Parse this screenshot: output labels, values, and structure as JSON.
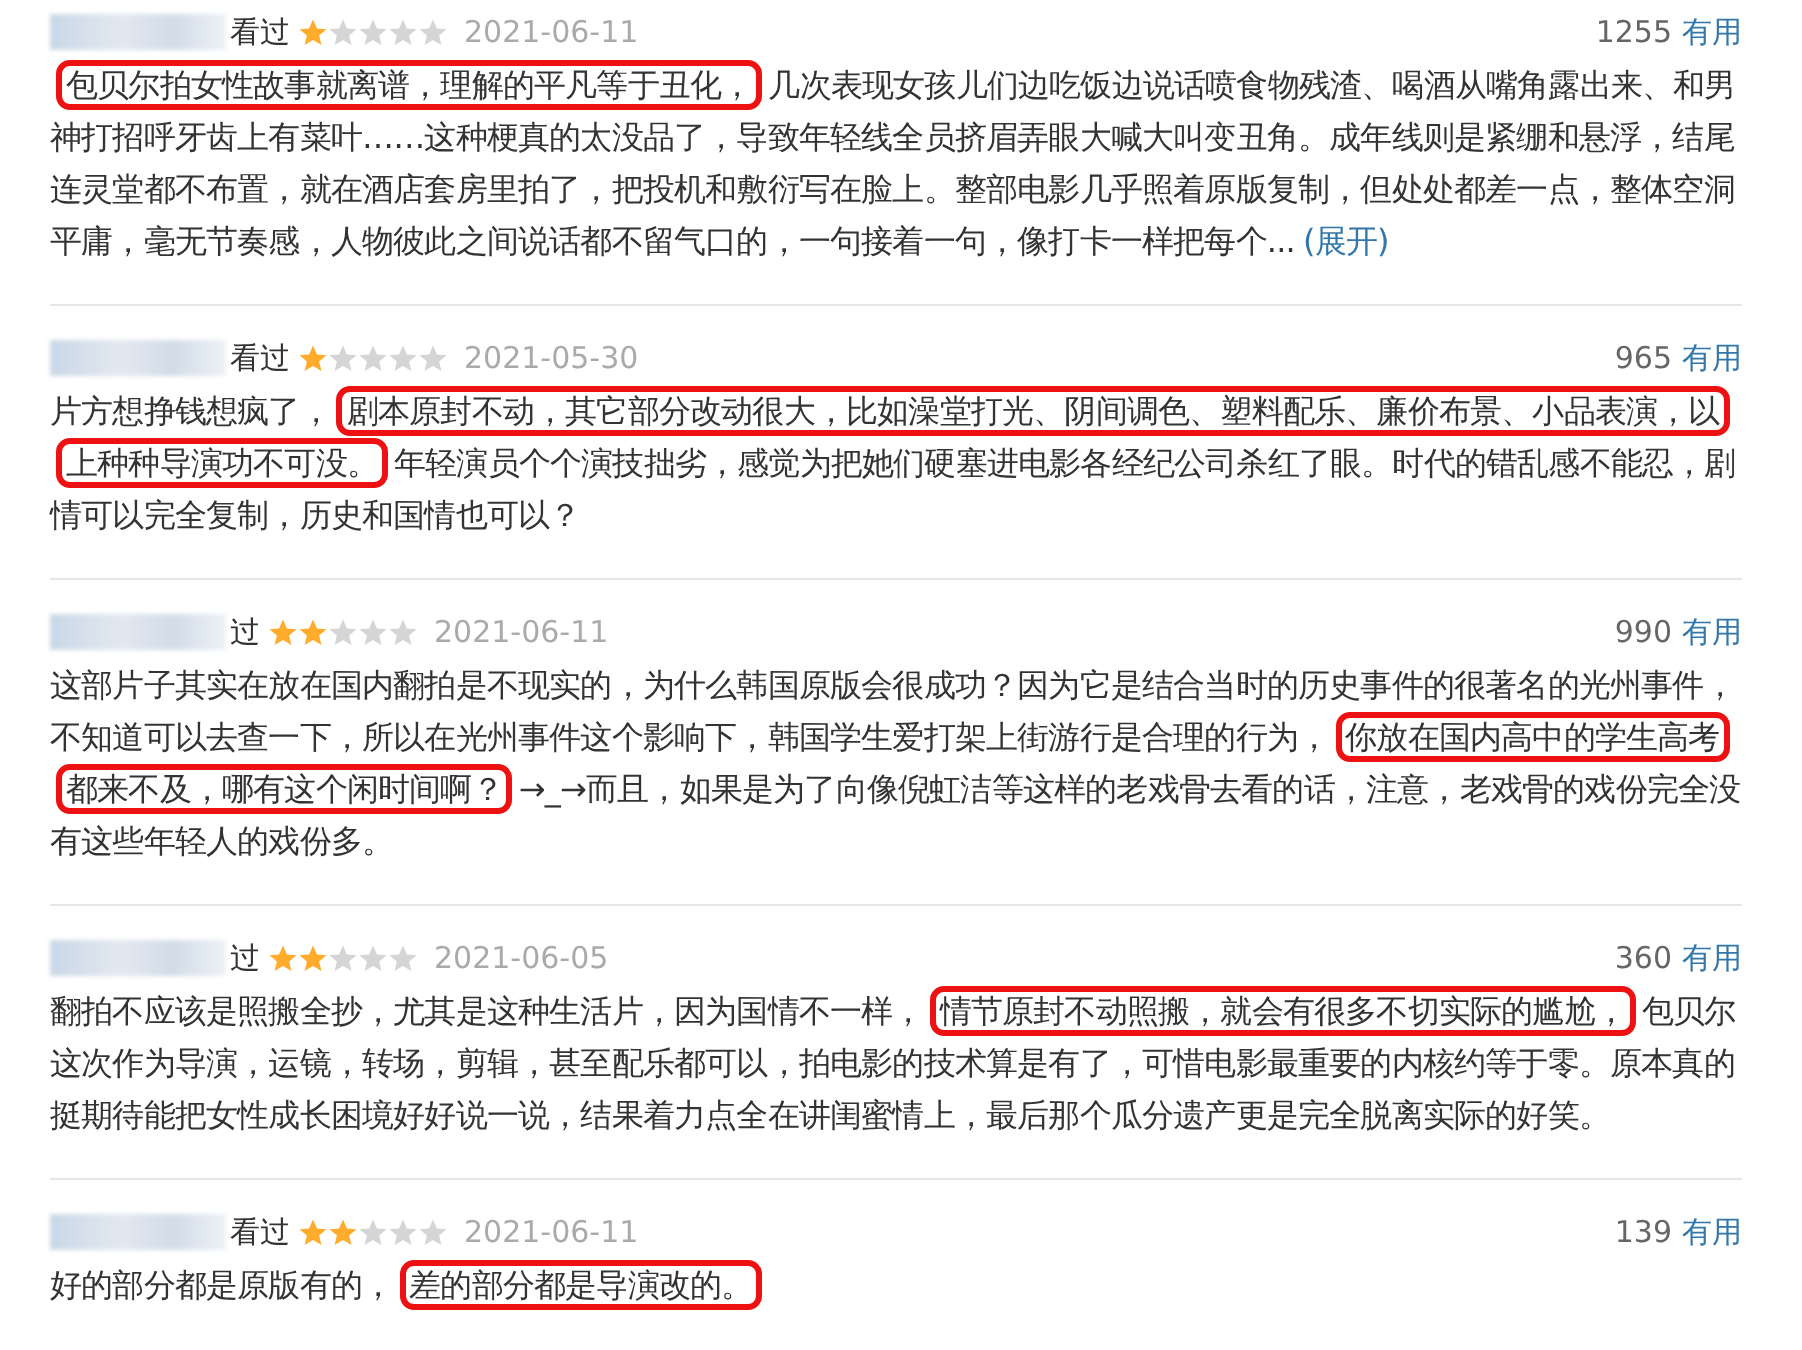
{
  "reviews": [
    {
      "watched": "看过",
      "stars": 1,
      "date": "2021-06-11",
      "votes": "1255",
      "useful": "有用",
      "segments": [
        {
          "text": "包贝尔拍女性故事就离谱，理解的平凡等于丑化，",
          "highlighted": true
        },
        {
          "text": "几次表现女孩儿们边吃饭边说话喷食物残渣、喝酒从嘴角露出来、和男神打招呼牙齿上有菜叶……这种梗真的太没品了，导致年轻线全员挤眉弄眼大喊大叫变丑角。成年线则是紧绷和悬浮，结尾连灵堂都不布置，就在酒店套房里拍了，把投机和敷衍写在脸上。整部电影几乎照着原版复制，但处处都差一点，整体空洞平庸，毫无节奏感，人物彼此之间说话都不留气口的，一句接着一句，像打卡一样把每个...",
          "highlighted": false
        }
      ],
      "expand": "(展开)"
    },
    {
      "watched": "看过",
      "stars": 1,
      "date": "2021-05-30",
      "votes": "965",
      "useful": "有用",
      "segments": [
        {
          "text": "片方想挣钱想疯了，",
          "highlighted": false
        },
        {
          "text": "剧本原封不动，其它部分改动很大，比如澡堂打光、阴间调色、塑料配乐、廉价布景、小品表演，以上种种导演功不可没。",
          "highlighted": true
        },
        {
          "text": "年轻演员个个演技拙劣，感觉为把她们硬塞进电影各经纪公司杀红了眼。时代的错乱感不能忍，剧情可以完全复制，历史和国情也可以？",
          "highlighted": false
        }
      ]
    },
    {
      "watched": "过",
      "stars": 2,
      "date": "2021-06-11",
      "votes": "990",
      "useful": "有用",
      "segments": [
        {
          "text": "这部片子其实在放在国内翻拍是不现实的，为什么韩国原版会很成功？因为它是结合当时的历史事件的很著名的光州事件，不知道可以去查一下，所以在光州事件这个影响下，韩国学生爱打架上街游行是合理的行为，",
          "highlighted": false
        },
        {
          "text": "你放在国内高中的学生高考都来不及，哪有这个闲时间啊？",
          "highlighted": true
        },
        {
          "text": "→_→而且，如果是为了向像倪虹洁等这样的老戏骨去看的话，注意，老戏骨的戏份完全没有这些年轻人的戏份多。",
          "highlighted": false
        }
      ]
    },
    {
      "watched": "过",
      "stars": 2,
      "date": "2021-06-05",
      "votes": "360",
      "useful": "有用",
      "segments": [
        {
          "text": "翻拍不应该是照搬全抄，尤其是这种生活片，因为国情不一样，",
          "highlighted": false
        },
        {
          "text": "情节原封不动照搬，就会有很多不切实际的尴尬，",
          "highlighted": true
        },
        {
          "text": "包贝尔这次作为导演，运镜，转场，剪辑，甚至配乐都可以，拍电影的技术算是有了，可惜电影最重要的内核约等于零。原本真的挺期待能把女性成长困境好好说一说，结果着力点全在讲闺蜜情上，最后那个瓜分遗产更是完全脱离实际的好笑。",
          "highlighted": false
        }
      ]
    },
    {
      "watched": "看过",
      "stars": 2,
      "date": "2021-06-11",
      "votes": "139",
      "useful": "有用",
      "segments": [
        {
          "text": "好的部分都是原版有的，",
          "highlighted": false
        },
        {
          "text": "差的部分都是导演改的。",
          "highlighted": true
        }
      ]
    }
  ]
}
